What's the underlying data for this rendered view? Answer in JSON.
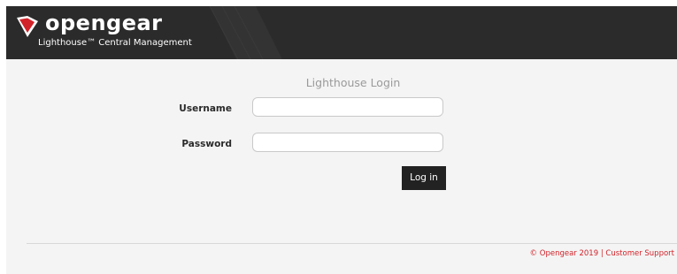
{
  "header": {
    "logo_text": "opengear",
    "subtitle": "Lighthouse™ Central Management",
    "colors": {
      "background": "#2b2b2b",
      "logo_mark": "#d2232a"
    }
  },
  "login": {
    "title": "Lighthouse Login",
    "username_label": "Username",
    "username_value": "",
    "password_label": "Password",
    "password_value": "",
    "submit_label": "Log in"
  },
  "footer": {
    "copyright": "© Opengear 2019",
    "separator": "|",
    "support_link": "Customer Support",
    "color": "#d2232a"
  }
}
